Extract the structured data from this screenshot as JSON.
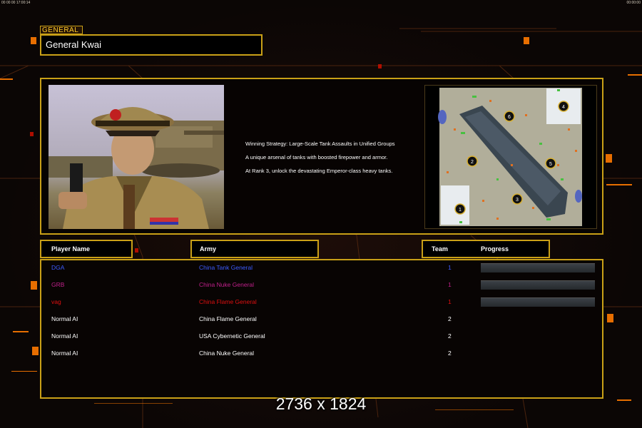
{
  "topbar": {
    "left_text": "00 00 00 17:00:14",
    "right_text": "00:00:00"
  },
  "section_tag": "GENERAL",
  "general_name": "General Kwai",
  "strategy": [
    "Winning Strategy: Large-Scale Tank Assaults in Unified Groups",
    "A unique arsenal of tanks with boosted firepower and armor.",
    "At Rank 3, unlock the devastating Emperor-class heavy tanks."
  ],
  "map": {
    "start_positions": [
      "1",
      "2",
      "3",
      "4",
      "5",
      "6"
    ]
  },
  "table": {
    "headers": {
      "player_name": "Player Name",
      "army": "Army",
      "team": "Team",
      "progress": "Progress"
    },
    "rows": [
      {
        "player": "DGA",
        "army": "China Tank General",
        "team": "1",
        "color": "#3d5cff",
        "has_bar": true
      },
      {
        "player": "GRB",
        "army": "China Nuke General",
        "team": "1",
        "color": "#c0208a",
        "has_bar": true
      },
      {
        "player": "vag",
        "army": "China Flame General",
        "team": "1",
        "color": "#e01010",
        "has_bar": true
      },
      {
        "player": "Normal AI",
        "army": "China Flame General",
        "team": "2",
        "color": "#ffffff",
        "has_bar": false
      },
      {
        "player": "Normal AI",
        "army": "USA Cybernetic General",
        "team": "2",
        "color": "#ffffff",
        "has_bar": false
      },
      {
        "player": "Normal AI",
        "army": "China Nuke General",
        "team": "2",
        "color": "#ffffff",
        "has_bar": false
      }
    ]
  },
  "resolution_caption": "2736 x 1824",
  "colors": {
    "accent_gold": "#c9a017",
    "accent_orange": "#ff7a00"
  }
}
